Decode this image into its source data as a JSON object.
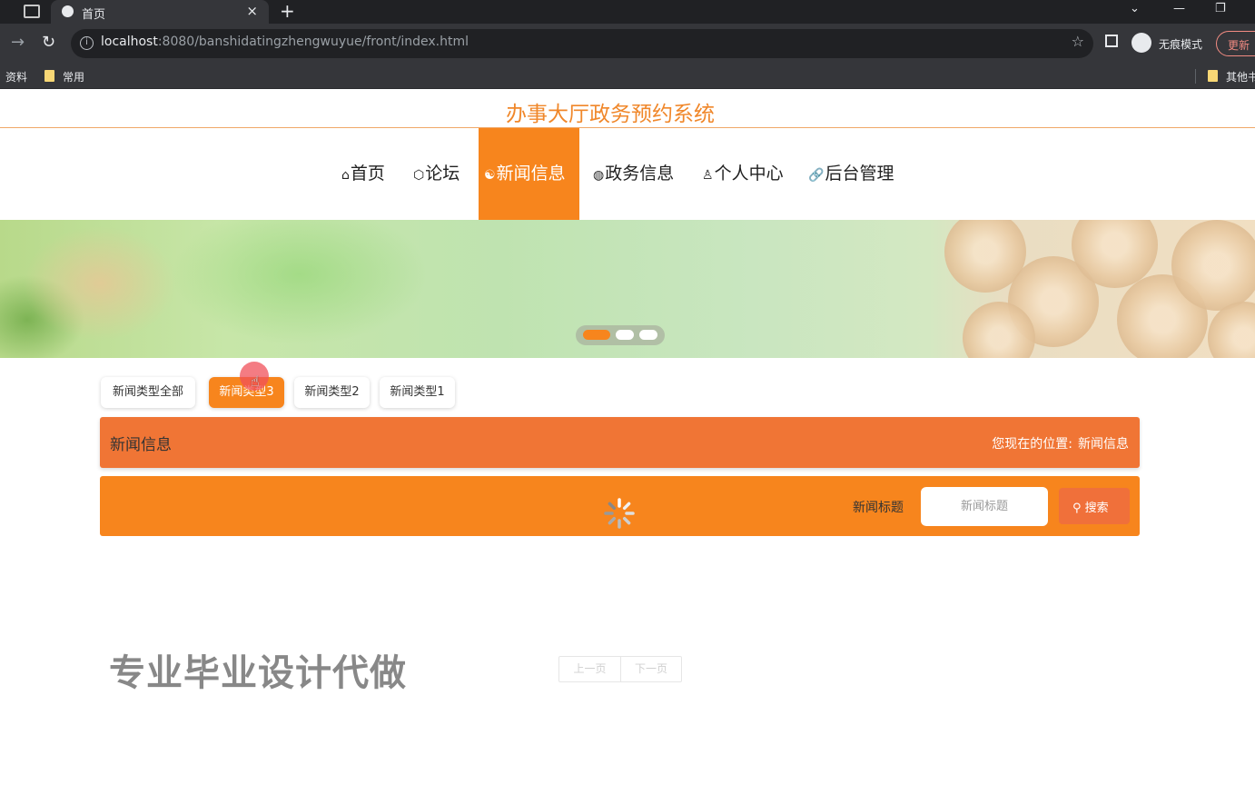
{
  "browser": {
    "tab_title": "首页",
    "tab_close": "×",
    "new_tab": "+",
    "url_host": "localhost",
    "url_rest": ":8080/banshidatingzhengwuyue/front/index.html",
    "incognito_label": "无痕模式",
    "update_label": "更新",
    "bookmarks": [
      "资料",
      "常用",
      "其他书签"
    ]
  },
  "site": {
    "title": "办事大厅政务预约系统",
    "nav": [
      {
        "icon": "⌂",
        "label": "首页"
      },
      {
        "icon": "⬡",
        "label": "论坛"
      },
      {
        "icon": "☯",
        "label": "新闻信息"
      },
      {
        "icon": "◍",
        "label": "政务信息"
      },
      {
        "icon": "♙",
        "label": "个人中心"
      },
      {
        "icon": "🔗",
        "label": "后台管理"
      }
    ],
    "active_nav_index": 2,
    "banner": {
      "slide_count": 3,
      "active_slide": 0
    },
    "categories": [
      "新闻类型全部",
      "新闻类型3",
      "新闻类型2",
      "新闻类型1"
    ],
    "active_category": 1
  },
  "section": {
    "title": "新闻信息",
    "location_label": "您现在的位置:",
    "location_value": "新闻信息"
  },
  "search": {
    "label": "新闻标题",
    "placeholder": "新闻标题",
    "button": "搜索"
  },
  "pager": {
    "prev": "上一页",
    "next": "下一页"
  },
  "watermark": "专业毕业设计代做",
  "colors": {
    "accent": "#f7851d",
    "header": "#f07535",
    "title": "#f0872a"
  }
}
